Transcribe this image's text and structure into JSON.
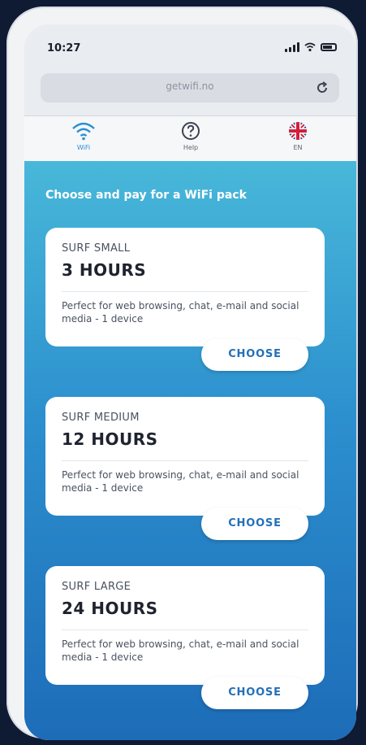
{
  "status": {
    "time": "10:27"
  },
  "browser": {
    "url": "getwifi.no"
  },
  "nav": {
    "items": [
      {
        "label": "WiFi",
        "icon": "wifi-icon",
        "active": true
      },
      {
        "label": "Help",
        "icon": "help-icon",
        "active": false
      },
      {
        "label": "EN",
        "icon": "uk-flag-icon",
        "active": false
      }
    ]
  },
  "main": {
    "headline": "Choose and pay for a WiFi pack",
    "packs": [
      {
        "name": "SURF SMALL",
        "duration": "3 HOURS",
        "description": "Perfect for web browsing, chat, e-mail and social media - 1 device",
        "button": "CHOOSE"
      },
      {
        "name": "SURF MEDIUM",
        "duration": "12 HOURS",
        "description": "Perfect for web browsing, chat, e-mail and social media - 1 device",
        "button": "CHOOSE"
      },
      {
        "name": "SURF LARGE",
        "duration": "24 HOURS",
        "description": "Perfect for web browsing, chat, e-mail and social media - 1 device",
        "button": "CHOOSE"
      }
    ]
  },
  "colors": {
    "accent": "#2b8fd6",
    "gradient_top": "#48b8d9",
    "gradient_bottom": "#1d6cb8",
    "button_text": "#2370b8"
  }
}
